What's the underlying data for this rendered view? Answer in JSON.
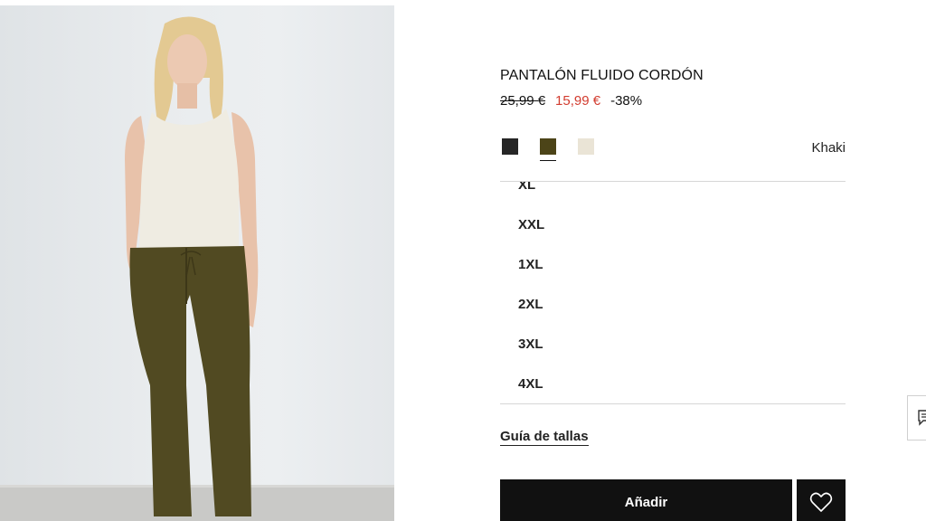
{
  "product": {
    "title": "PANTALÓN FLUIDO CORDÓN",
    "price_old": "25,99 €",
    "price_new": "15,99 €",
    "discount": "-38%"
  },
  "colors": {
    "selected_name": "Khaki",
    "swatches": [
      {
        "name": "black",
        "hex": "#262626"
      },
      {
        "name": "khaki",
        "hex": "#4c4418"
      },
      {
        "name": "cream",
        "hex": "#eae4d6"
      }
    ]
  },
  "sizes": [
    "XL",
    "XXL",
    "1XL",
    "2XL",
    "3XL",
    "4XL"
  ],
  "links": {
    "size_guide": "Guía de tallas"
  },
  "actions": {
    "add_label": "Añadir",
    "wishlist_icon": "heart-icon"
  },
  "side_tab": {
    "icon": "chat-icon"
  }
}
